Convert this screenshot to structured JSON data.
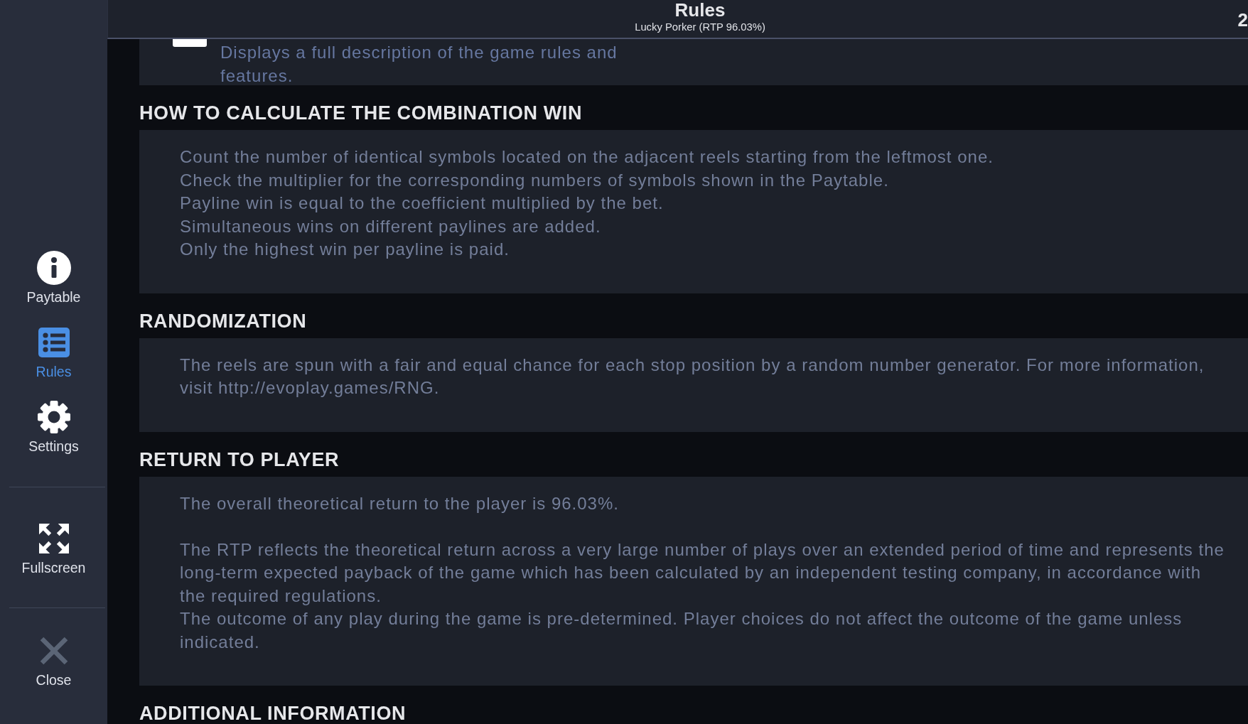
{
  "sidebar": {
    "sections": [
      {
        "items": [
          {
            "kind": "info",
            "label": "Paytable",
            "selected": false
          },
          {
            "kind": "rules",
            "label": "Rules",
            "selected": true
          },
          {
            "kind": "settings",
            "label": "Settings",
            "selected": false
          }
        ]
      },
      {
        "items": [
          {
            "kind": "fullscreen",
            "label": "Fullscreen",
            "selected": false
          }
        ]
      },
      {
        "items": [
          {
            "kind": "close",
            "label": "Close",
            "selected": false
          }
        ]
      }
    ]
  },
  "header": {
    "title": "Rules",
    "subtitle": "Lucky Porker (RTP 96.03%)",
    "corner_text": "2"
  },
  "intro": {
    "text": "Displays a full description of the game rules and features."
  },
  "sections": [
    {
      "heading": "HOW TO CALCULATE THE COMBINATION WIN",
      "paragraphs": [
        [
          "Count the number of identical symbols located on the adjacent reels starting from the leftmost one.",
          "Check the multiplier for the corresponding numbers of symbols shown in the Paytable.",
          "Payline win is equal to the coefficient multiplied by the bet.",
          "Simultaneous wins on different paylines are added.",
          "Only the highest win per payline is paid."
        ]
      ]
    },
    {
      "heading": "RANDOMIZATION",
      "paragraphs": [
        [
          "The reels are spun with a fair and equal chance for each stop position by a random number generator. For more information, visit http://evoplay.games/RNG."
        ]
      ]
    },
    {
      "heading": "RETURN TO PLAYER",
      "paragraphs": [
        [
          "The overall theoretical return to the player is 96.03%."
        ],
        [
          "The RTP reflects the theoretical return across a very large number of plays over an extended period of time and represents the long-term expected payback of the game which has been calculated by an independent testing company, in accordance with the required regulations.",
          "The outcome of any play during the game is pre-determined. Player choices do not affect the outcome of the game unless indicated."
        ]
      ]
    },
    {
      "heading": "ADDITIONAL INFORMATION"
    }
  ]
}
